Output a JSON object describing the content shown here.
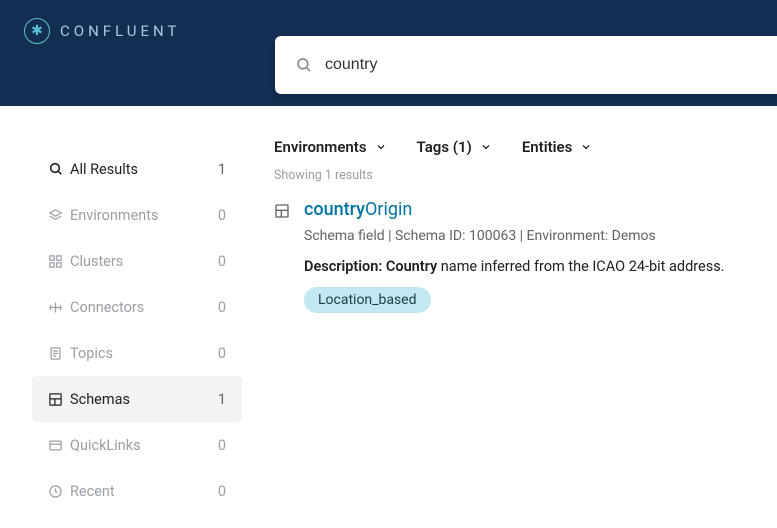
{
  "brand": {
    "name": "CONFLUENT"
  },
  "search": {
    "value": "country"
  },
  "sidebar": {
    "items": [
      {
        "label": "All Results",
        "count": "1",
        "icon": "search-icon",
        "all": true,
        "active": false
      },
      {
        "label": "Environments",
        "count": "0",
        "icon": "layers-icon",
        "all": false,
        "active": false
      },
      {
        "label": "Clusters",
        "count": "0",
        "icon": "grid-icon",
        "all": false,
        "active": false
      },
      {
        "label": "Connectors",
        "count": "0",
        "icon": "connector-icon",
        "all": false,
        "active": false
      },
      {
        "label": "Topics",
        "count": "0",
        "icon": "document-icon",
        "all": false,
        "active": false
      },
      {
        "label": "Schemas",
        "count": "1",
        "icon": "schema-icon",
        "all": false,
        "active": true
      },
      {
        "label": "QuickLinks",
        "count": "0",
        "icon": "quicklinks-icon",
        "all": false,
        "active": false
      },
      {
        "label": "Recent",
        "count": "0",
        "icon": "recent-icon",
        "all": false,
        "active": false
      }
    ]
  },
  "filters": [
    {
      "label": "Environments"
    },
    {
      "label": "Tags (1)"
    },
    {
      "label": "Entities"
    }
  ],
  "resultsCount": "Showing 1 results",
  "result": {
    "titleMatch": "country",
    "titleRest": "Origin",
    "meta": "Schema field | Schema ID: 100063 | Environment: Demos",
    "descLabel": "Description: ",
    "descMatch": "Country",
    "descRest": " name inferred from the ICAO 24-bit address.",
    "tag": "Location_based"
  }
}
